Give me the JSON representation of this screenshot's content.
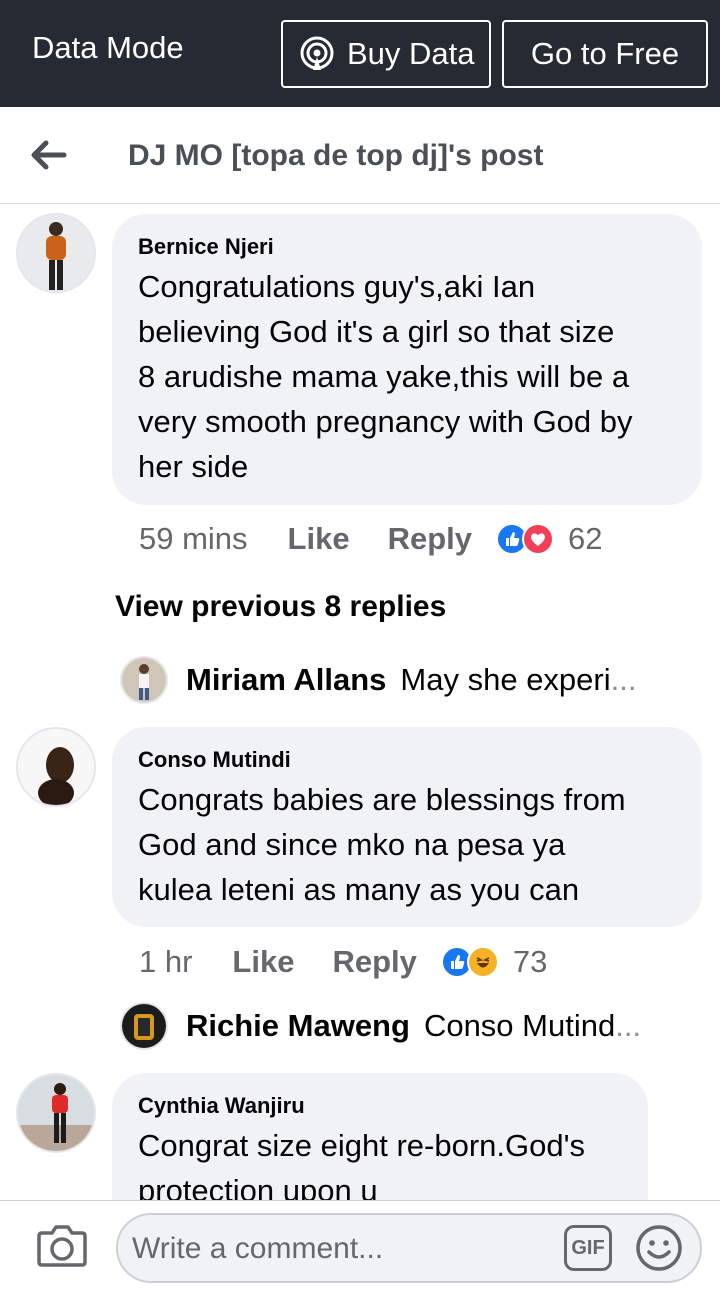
{
  "databar": {
    "mode_label": "Data Mode",
    "buy_label": "Buy Data",
    "free_label": "Go to Free"
  },
  "header": {
    "title": "DJ MO [topa de top dj]'s post"
  },
  "comments": [
    {
      "author": "Bernice Njeri",
      "lines": [
        "Congratulations guy's,aki Ian",
        "believing God it's a girl so that size",
        "8 arudishe mama yake,this will be a",
        "very smooth pregnancy with God by",
        "her side"
      ],
      "time": "59 mins",
      "like_label": "Like",
      "reply_label": "Reply",
      "reaction_count": "62",
      "reactions": [
        "like-icon",
        "love-icon"
      ]
    },
    {
      "author": "Conso Mutindi",
      "lines": [
        "Congrats babies are blessings from",
        "God and since mko na pesa ya",
        "kulea leteni as many as you can"
      ],
      "time": "1 hr",
      "like_label": "Like",
      "reply_label": "Reply",
      "reaction_count": "73",
      "reactions": [
        "like-icon",
        "haha-icon"
      ]
    },
    {
      "author": "Cynthia Wanjiru",
      "lines": [
        "Congrat size eight re-born.God's",
        "protection upon u"
      ]
    }
  ],
  "view_previous": "View previous 8 replies",
  "replies": [
    {
      "name": "Miriam Allans",
      "text": "May she experi",
      "ellipsis": "..."
    },
    {
      "name": "Richie Maweng",
      "text": "Conso Mutind",
      "ellipsis": "..."
    }
  ],
  "composer": {
    "placeholder": "Write a comment...",
    "gif_label": "GIF"
  },
  "colors": {
    "databar_bg": "#252a33",
    "bubble_bg": "#f0f2f5",
    "like_blue": "#1877f2",
    "love_red": "#f33e58",
    "haha_yellow": "#f7b125"
  }
}
